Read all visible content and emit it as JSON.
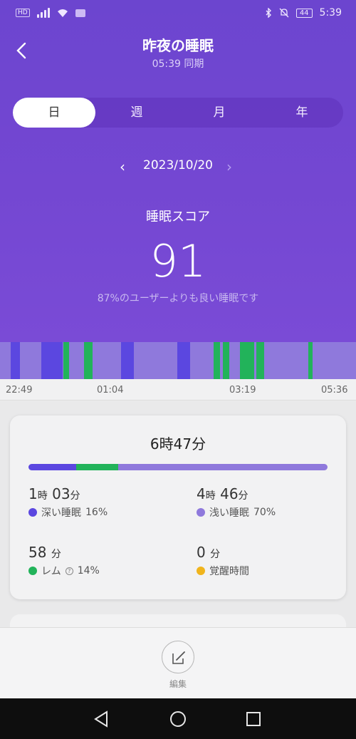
{
  "status_bar": {
    "network": "HD",
    "battery": "44",
    "time": "5:39"
  },
  "header": {
    "title": "昨夜の睡眠",
    "subtitle": "05:39 同期"
  },
  "tabs": [
    {
      "label": "日",
      "active": true
    },
    {
      "label": "週",
      "active": false
    },
    {
      "label": "月",
      "active": false
    },
    {
      "label": "年",
      "active": false
    }
  ],
  "date_nav": {
    "date": "2023/10/20"
  },
  "score": {
    "label": "睡眠スコア",
    "value": "91",
    "description": "87%のユーザーよりも良い睡眠です"
  },
  "timeline": {
    "axis_labels": [
      "22:49",
      "01:04",
      "03:19",
      "05:36"
    ],
    "colors": {
      "deep": "#5b47e0",
      "light": "#8f79dc",
      "rem": "#22b35a",
      "awake": "#f0b41c"
    }
  },
  "summary": {
    "total": "6時47分",
    "proportions": {
      "deep": 16,
      "rem": 14,
      "light": 70
    },
    "deep": {
      "hours": "1",
      "h_unit": "時",
      "minutes": "03",
      "m_unit": "分",
      "label": "深い睡眠",
      "percent": "16%"
    },
    "light": {
      "hours": "4",
      "h_unit": "時",
      "minutes": "46",
      "m_unit": "分",
      "label": "浅い睡眠",
      "percent": "70%"
    },
    "rem": {
      "minutes": "58",
      "m_unit": "分",
      "label": "レム",
      "help": "?",
      "percent": "14%"
    },
    "awake": {
      "minutes": "0",
      "m_unit": "分",
      "label": "覚醒時間"
    }
  },
  "bottom": {
    "edit_label": "編集"
  }
}
